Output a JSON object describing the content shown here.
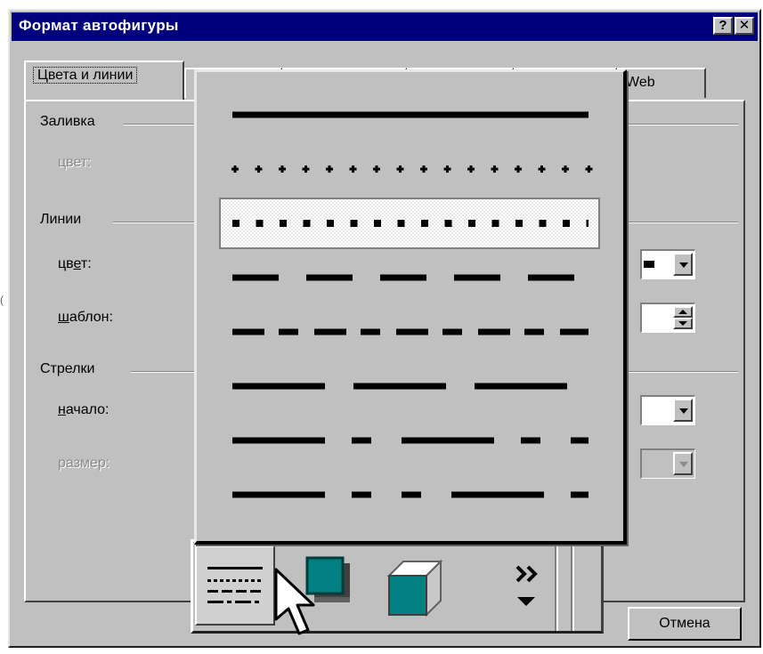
{
  "dialog": {
    "title": "Формат автофигуры",
    "help_label": "?",
    "close_label": "✕",
    "tabs": [
      {
        "label": "Цвета и линии",
        "active": true
      },
      {
        "label": "",
        "active": false
      },
      {
        "label": "",
        "active": false
      },
      {
        "label": "",
        "active": false
      },
      {
        "label": "",
        "active": false
      },
      {
        "label": "Web",
        "active": false
      }
    ]
  },
  "fill_section": {
    "heading": "Заливка",
    "color_label": "цвет:"
  },
  "lines_section": {
    "heading": "Линии",
    "color_label_pre": "цв",
    "color_label_u": "е",
    "color_label_post": "т:",
    "color_value": "#5a1ee8",
    "pattern_label_u": "ш",
    "pattern_label_post": "аблон:"
  },
  "arrows_section": {
    "heading": "Стрелки",
    "start_label_u": "н",
    "start_label_post": "ачало:",
    "size_label": "размер:"
  },
  "dash_popup": {
    "styles": [
      {
        "name": "solid"
      },
      {
        "name": "round-dot"
      },
      {
        "name": "square-dot",
        "selected": true
      },
      {
        "name": "dash"
      },
      {
        "name": "dash-dot"
      },
      {
        "name": "long-dash"
      },
      {
        "name": "long-dash-dot"
      },
      {
        "name": "long-dash-dot-dot"
      }
    ]
  },
  "toolbar": {
    "buttons": [
      {
        "icon": "dash-style-icon",
        "pressed": true
      },
      {
        "icon": "shadow-icon"
      },
      {
        "icon": "3d-icon"
      },
      {
        "icon": "more-buttons-icon",
        "label": "»"
      }
    ]
  },
  "buttons": {
    "cancel_label": "Отмена"
  },
  "side_mark": "("
}
